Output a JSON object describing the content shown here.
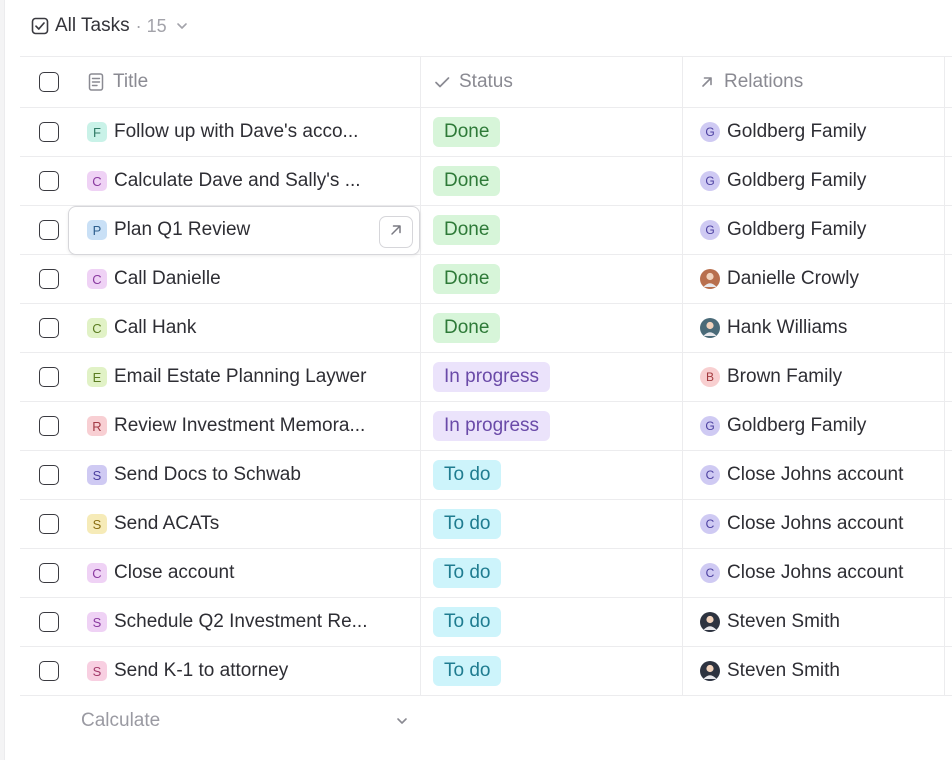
{
  "header": {
    "title": "All Tasks",
    "count": "· 15",
    "icon": "checkbox-list-icon"
  },
  "columns": {
    "title": "Title",
    "status": "Status",
    "relations": "Relations"
  },
  "rows": [
    {
      "badge": "F",
      "badge_bg": "#c9f2e8",
      "badge_fg": "#2f7a66",
      "title": "Follow up with Dave's acco...",
      "status": "Done",
      "status_kind": "done",
      "rel_initial": "G",
      "rel_bg": "#cfcaf3",
      "rel_fg": "#4b3fa0",
      "relation": "Goldberg Family"
    },
    {
      "badge": "C",
      "badge_bg": "#efd2f5",
      "badge_fg": "#8a3aa0",
      "title": "Calculate Dave and Sally's ...",
      "status": "Done",
      "status_kind": "done",
      "rel_initial": "G",
      "rel_bg": "#cfcaf3",
      "rel_fg": "#4b3fa0",
      "relation": "Goldberg Family"
    },
    {
      "badge": "P",
      "badge_bg": "#c9e0f6",
      "badge_fg": "#2e5f8e",
      "title": "Plan Q1 Review",
      "status": "Done",
      "status_kind": "done",
      "rel_initial": "G",
      "rel_bg": "#cfcaf3",
      "rel_fg": "#4b3fa0",
      "relation": "Goldberg Family"
    },
    {
      "badge": "C",
      "badge_bg": "#efd2f5",
      "badge_fg": "#8a3aa0",
      "title": "Call Danielle",
      "status": "Done",
      "status_kind": "done",
      "rel_initial": "",
      "rel_bg": "#b86f4d",
      "rel_fg": "#ffffff",
      "relation": "Danielle Crowly"
    },
    {
      "badge": "C",
      "badge_bg": "#e1f2c6",
      "badge_fg": "#5c7d22",
      "title": "Call Hank",
      "status": "Done",
      "status_kind": "done",
      "rel_initial": "",
      "rel_bg": "#4a6a78",
      "rel_fg": "#ffffff",
      "relation": "Hank Williams"
    },
    {
      "badge": "E",
      "badge_bg": "#e1f2c6",
      "badge_fg": "#5c7d22",
      "title": "Email Estate Planning Laywer",
      "status": "In progress",
      "status_kind": "prog",
      "rel_initial": "B",
      "rel_bg": "#f8cfd0",
      "rel_fg": "#a33a3e",
      "relation": "Brown Family"
    },
    {
      "badge": "R",
      "badge_bg": "#f8cfd3",
      "badge_fg": "#a33a46",
      "title": "Review Investment Memora...",
      "status": "In progress",
      "status_kind": "prog",
      "rel_initial": "G",
      "rel_bg": "#cfcaf3",
      "rel_fg": "#4b3fa0",
      "relation": "Goldberg Family"
    },
    {
      "badge": "S",
      "badge_bg": "#cfcaf3",
      "badge_fg": "#4b3fa0",
      "title": "Send Docs to Schwab",
      "status": "To do",
      "status_kind": "todo",
      "rel_initial": "C",
      "rel_bg": "#cfcaf3",
      "rel_fg": "#4b3fa0",
      "relation": "Close Johns account"
    },
    {
      "badge": "S",
      "badge_bg": "#f6ebb8",
      "badge_fg": "#8a6f12",
      "title": "Send ACATs",
      "status": "To do",
      "status_kind": "todo",
      "rel_initial": "C",
      "rel_bg": "#cfcaf3",
      "rel_fg": "#4b3fa0",
      "relation": "Close Johns account"
    },
    {
      "badge": "C",
      "badge_bg": "#efd2f5",
      "badge_fg": "#8a3aa0",
      "title": "Close account",
      "status": "To do",
      "status_kind": "todo",
      "rel_initial": "C",
      "rel_bg": "#cfcaf3",
      "rel_fg": "#4b3fa0",
      "relation": "Close Johns account"
    },
    {
      "badge": "S",
      "badge_bg": "#efd2f5",
      "badge_fg": "#8a3aa0",
      "title": "Schedule Q2 Investment Re...",
      "status": "To do",
      "status_kind": "todo",
      "rel_initial": "",
      "rel_bg": "#2d3340",
      "rel_fg": "#ffffff",
      "relation": "Steven Smith"
    },
    {
      "badge": "S",
      "badge_bg": "#f8cfe1",
      "badge_fg": "#a33a6a",
      "title": "Send K-1 to attorney",
      "status": "To do",
      "status_kind": "todo",
      "rel_initial": "",
      "rel_bg": "#2d3340",
      "rel_fg": "#ffffff",
      "relation": "Steven Smith"
    }
  ],
  "footer": {
    "calculate": "Calculate"
  }
}
